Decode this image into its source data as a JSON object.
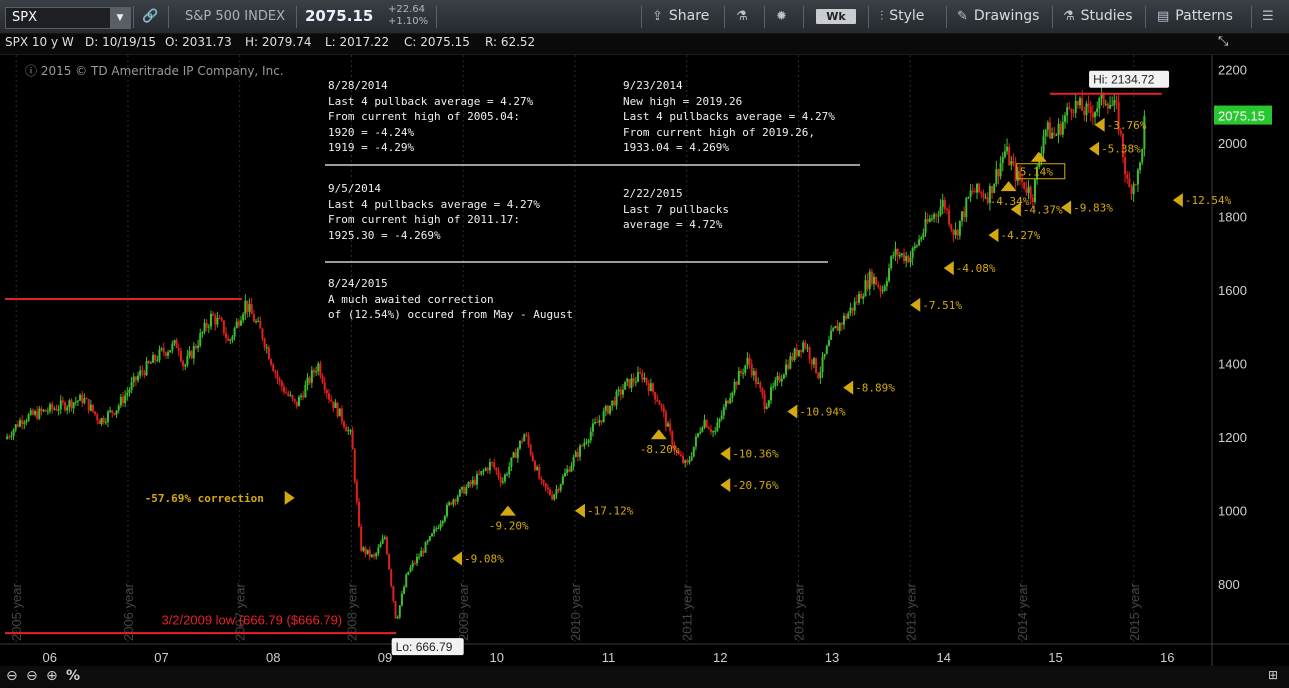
{
  "toolbar": {
    "symbol": "SPX",
    "index_name": "S&P 500 INDEX",
    "last_price": "2075.15",
    "change": "+22.64",
    "change_pct": "+1.10%",
    "share_label": "Share",
    "aggregation": "Wk",
    "style_label": "Style",
    "drawings_label": "Drawings",
    "studies_label": "Studies",
    "patterns_label": "Patterns"
  },
  "info": {
    "title": "SPX 10 y W",
    "date": "D: 10/19/15",
    "open": "O: 2031.73",
    "high": "H: 2079.74",
    "low": "L: 2017.22",
    "close": "C: 2075.15",
    "range": "R: 62.52"
  },
  "copyright": "2015 © TD Ameritrade IP Company, Inc.",
  "notes": {
    "n1": "8/28/2014\nLast 4 pullback average = 4.27%\nFrom current high of 2005.04:\n1920 = -4.24%\n1919 = -4.29%",
    "n2": "9/23/2014\nNew high = 2019.26\nLast 4 pullbacks average = 4.27%\nFrom current high of 2019.26,\n1933.04 = 4.269%",
    "n3": "9/5/2014\nLast 4 pullbacks average = 4.27%\nFrom current high of 2011.17:\n1925.30 = -4.269%",
    "n4": "2/22/2015\nLast 7 pullbacks\naverage = 4.72%",
    "n5": "8/24/2015\nA much awaited correction\nof (12.54%) occured from May - August"
  },
  "colors": {
    "up": "#3fbf2f",
    "down": "#e0201c",
    "annotation": "#d4a90f",
    "level_line": "#e8202a",
    "price_tag": "#29c72f"
  },
  "chart_data": {
    "type": "candlestick",
    "xlim": [
      2005.6,
      2016.4
    ],
    "ylim": [
      640,
      2240
    ],
    "x_ticks": [
      "06",
      "07",
      "08",
      "09",
      "10",
      "11",
      "12",
      "13",
      "14",
      "15",
      "16"
    ],
    "x_tick_values": [
      2006,
      2007,
      2008,
      2009,
      2010,
      2011,
      2012,
      2013,
      2014,
      2015,
      2016
    ],
    "y_ticks": [
      800,
      1000,
      1200,
      1400,
      1600,
      1800,
      2000,
      2200
    ],
    "year_labels": [
      "2005 year",
      "2006 year",
      "2007 year",
      "2008 year",
      "2009 year",
      "2010 year",
      "2011 year",
      "2012 year",
      "2013 year",
      "2014 year",
      "2015 year"
    ],
    "year_label_x": [
      2005.7,
      2006.7,
      2007.7,
      2008.7,
      2009.7,
      2010.7,
      2011.7,
      2012.7,
      2013.7,
      2014.7,
      2015.7
    ],
    "path": [
      [
        2005.6,
        1195
      ],
      [
        2005.75,
        1250
      ],
      [
        2006.0,
        1275
      ],
      [
        2006.3,
        1305
      ],
      [
        2006.45,
        1245
      ],
      [
        2006.6,
        1280
      ],
      [
        2006.8,
        1370
      ],
      [
        2007.0,
        1430
      ],
      [
        2007.15,
        1455
      ],
      [
        2007.2,
        1390
      ],
      [
        2007.45,
        1530
      ],
      [
        2007.55,
        1500
      ],
      [
        2007.6,
        1455
      ],
      [
        2007.75,
        1565
      ],
      [
        2007.9,
        1480
      ],
      [
        2008.05,
        1350
      ],
      [
        2008.2,
        1285
      ],
      [
        2008.4,
        1400
      ],
      [
        2008.5,
        1310
      ],
      [
        2008.6,
        1260
      ],
      [
        2008.7,
        1200
      ],
      [
        2008.78,
        900
      ],
      [
        2008.9,
        870
      ],
      [
        2009.0,
        930
      ],
      [
        2009.1,
        700
      ],
      [
        2009.2,
        830
      ],
      [
        2009.4,
        920
      ],
      [
        2009.6,
        1030
      ],
      [
        2009.8,
        1080
      ],
      [
        2009.95,
        1130
      ],
      [
        2010.05,
        1080
      ],
      [
        2010.25,
        1210
      ],
      [
        2010.4,
        1070
      ],
      [
        2010.5,
        1040
      ],
      [
        2010.65,
        1120
      ],
      [
        2010.85,
        1220
      ],
      [
        2011.0,
        1280
      ],
      [
        2011.15,
        1340
      ],
      [
        2011.3,
        1370
      ],
      [
        2011.45,
        1300
      ],
      [
        2011.6,
        1160
      ],
      [
        2011.7,
        1120
      ],
      [
        2011.85,
        1250
      ],
      [
        2011.95,
        1210
      ],
      [
        2012.1,
        1330
      ],
      [
        2012.25,
        1410
      ],
      [
        2012.4,
        1290
      ],
      [
        2012.6,
        1400
      ],
      [
        2012.75,
        1460
      ],
      [
        2012.88,
        1370
      ],
      [
        2013.0,
        1480
      ],
      [
        2013.2,
        1560
      ],
      [
        2013.35,
        1640
      ],
      [
        2013.45,
        1600
      ],
      [
        2013.55,
        1700
      ],
      [
        2013.7,
        1690
      ],
      [
        2013.85,
        1780
      ],
      [
        2014.0,
        1840
      ],
      [
        2014.1,
        1750
      ],
      [
        2014.25,
        1870
      ],
      [
        2014.4,
        1860
      ],
      [
        2014.55,
        1980
      ],
      [
        2014.65,
        1910
      ],
      [
        2014.8,
        1860
      ],
      [
        2014.9,
        2040
      ],
      [
        2015.0,
        2020
      ],
      [
        2015.15,
        2110
      ],
      [
        2015.3,
        2080
      ],
      [
        2015.45,
        2125
      ],
      [
        2015.55,
        2085
      ],
      [
        2015.65,
        1870
      ],
      [
        2015.75,
        1920
      ],
      [
        2015.8,
        2075
      ]
    ],
    "hi_label": "Hi: 2134.72",
    "hi_value": 2134.72,
    "lo_label": "Lo: 666.79",
    "lo_value": 666.79,
    "lo_text": "3/2/2009 low (666.79 ($666.79)",
    "last_price": 2075.15,
    "levels": [
      {
        "name": "2007-high",
        "value": 1576,
        "from": 2005.6,
        "to": 2007.72
      },
      {
        "name": "2009-low",
        "value": 666.79,
        "from": 2005.6,
        "to": 2009.1
      },
      {
        "name": "2015-high",
        "value": 2134.72,
        "from": 2014.95,
        "to": 2015.95
      }
    ],
    "annotations": [
      {
        "text": "-57.69% correction",
        "x": 2006.85,
        "y": 1035,
        "arrow": "right"
      },
      {
        "text": "-9.08%",
        "x": 2009.6,
        "y": 870,
        "arrow": "left"
      },
      {
        "text": "-9.20%",
        "x": 2010.1,
        "y": 992,
        "arrow": "up"
      },
      {
        "text": "-17.12%",
        "x": 2010.7,
        "y": 1000,
        "arrow": "left"
      },
      {
        "text": "-8.20%",
        "x": 2011.45,
        "y": 1200,
        "arrow": "up"
      },
      {
        "text": "-20.76%",
        "x": 2012.0,
        "y": 1070,
        "arrow": "left"
      },
      {
        "text": "-10.36%",
        "x": 2012.0,
        "y": 1155,
        "arrow": "left"
      },
      {
        "text": "-10.94%",
        "x": 2012.6,
        "y": 1270,
        "arrow": "left"
      },
      {
        "text": "-8.89%",
        "x": 2013.1,
        "y": 1335,
        "arrow": "left"
      },
      {
        "text": "-7.51%",
        "x": 2013.7,
        "y": 1560,
        "arrow": "left"
      },
      {
        "text": "-4.08%",
        "x": 2014.0,
        "y": 1660,
        "arrow": "left"
      },
      {
        "text": "-4.27%",
        "x": 2014.4,
        "y": 1750,
        "arrow": "left"
      },
      {
        "text": "-4.37%",
        "x": 2014.6,
        "y": 1820,
        "arrow": "left"
      },
      {
        "text": "-4.34%",
        "x": 2014.58,
        "y": 1875,
        "arrow": "up"
      },
      {
        "text": "-9.83%",
        "x": 2015.05,
        "y": 1825,
        "arrow": "left"
      },
      {
        "text": "5.14%",
        "x": 2014.85,
        "y": 1955,
        "arrow": "up",
        "boxed": true
      },
      {
        "text": "-5.38%",
        "x": 2015.3,
        "y": 1985,
        "arrow": "left"
      },
      {
        "text": "-3.76%",
        "x": 2015.35,
        "y": 2050,
        "arrow": "left"
      },
      {
        "text": "-12.54%",
        "x": 2016.05,
        "y": 1845,
        "arrow": "left"
      }
    ]
  }
}
